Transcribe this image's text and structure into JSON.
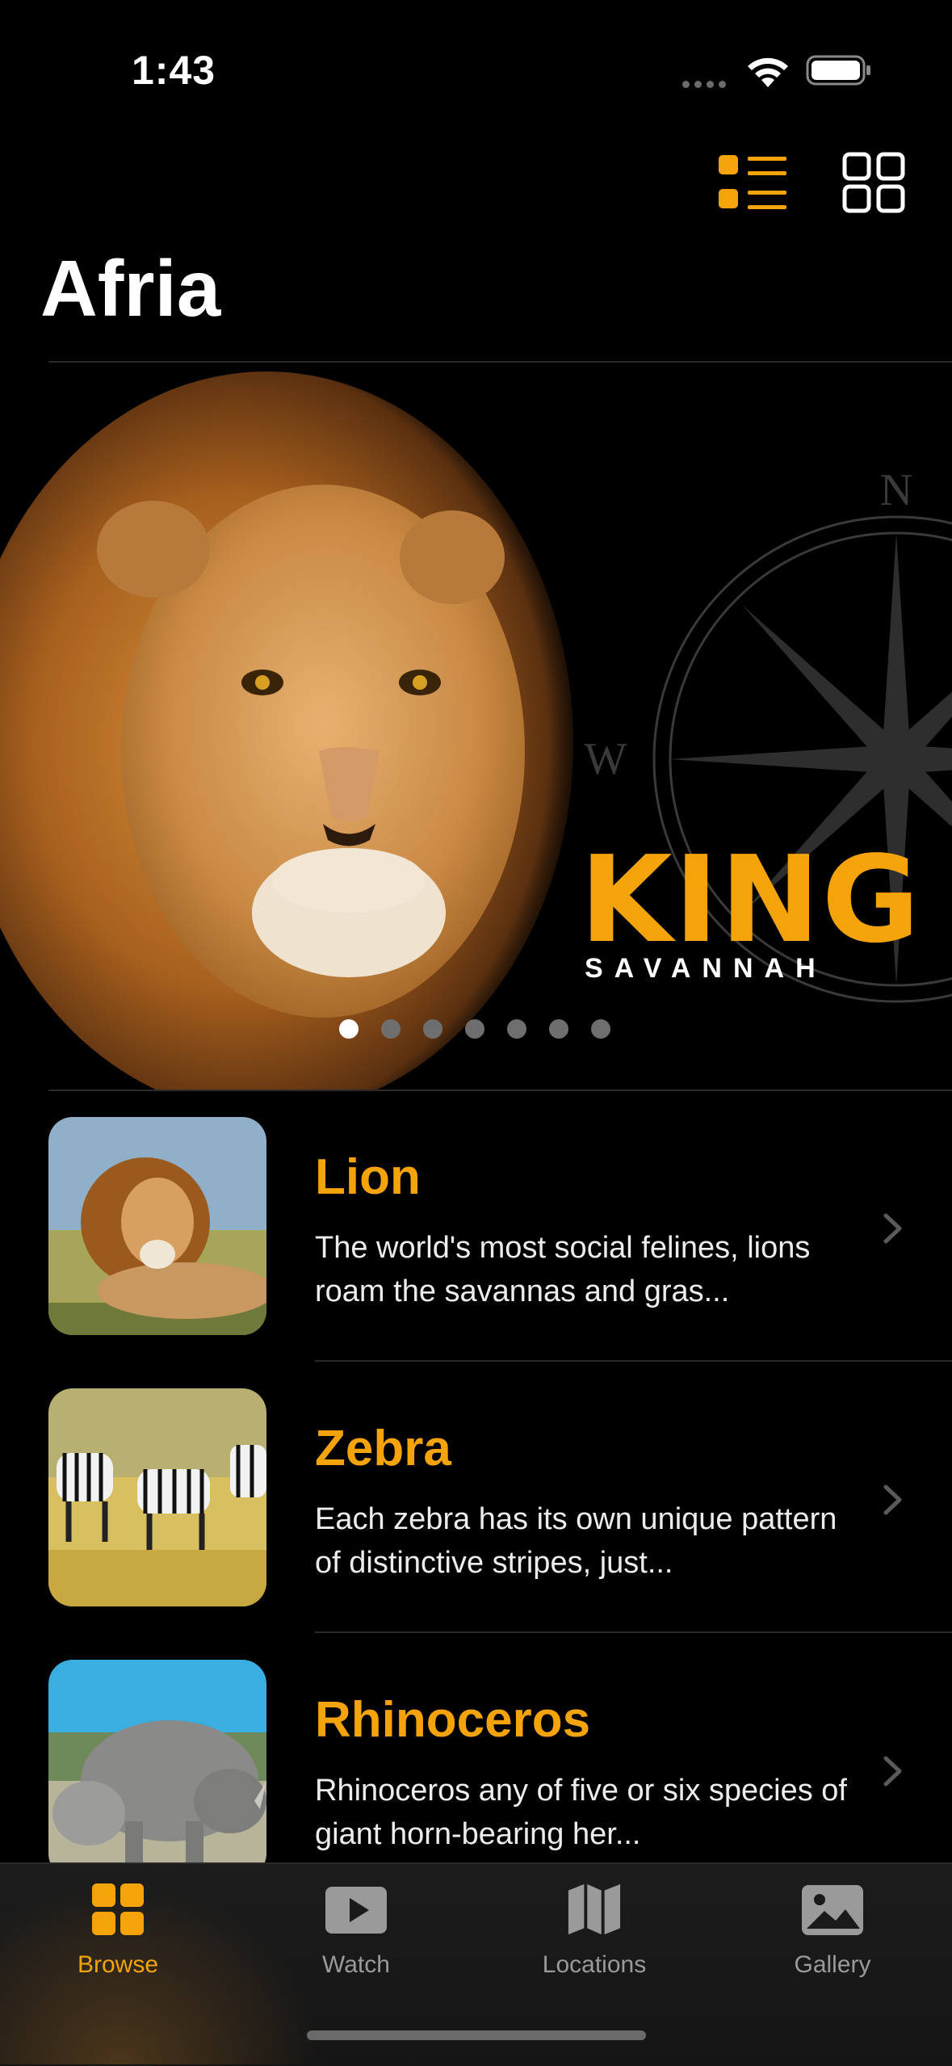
{
  "status_bar": {
    "time": "1:43"
  },
  "header": {
    "title": "Afria"
  },
  "hero": {
    "title": "KING",
    "subtitle": "SAVANNAH",
    "page_count": 7,
    "active_page": 1
  },
  "animals": [
    {
      "name": "Lion",
      "description": "The world's most social felines, lions roam the savannas and gras..."
    },
    {
      "name": "Zebra",
      "description": "Each zebra has its own unique pattern of distinctive stripes, just..."
    },
    {
      "name": "Rhinoceros",
      "description": "Rhinoceros any of five or six species of giant horn-bearing her..."
    }
  ],
  "tabs": [
    {
      "label": "Browse",
      "icon": "grid-icon",
      "active": true
    },
    {
      "label": "Watch",
      "icon": "play-icon",
      "active": false
    },
    {
      "label": "Locations",
      "icon": "map-icon",
      "active": false
    },
    {
      "label": "Gallery",
      "icon": "photo-icon",
      "active": false
    }
  ],
  "colors": {
    "accent": "#f5a30b",
    "background": "#000000",
    "inactive": "#9a9a9a"
  }
}
